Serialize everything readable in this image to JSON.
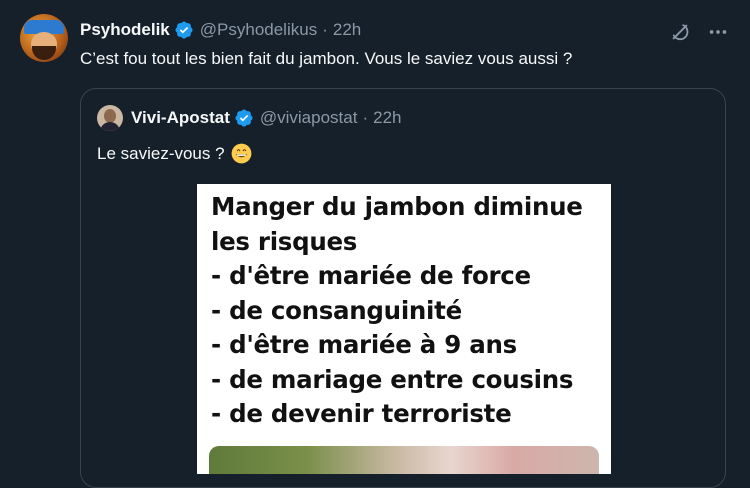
{
  "tweet": {
    "author_name": "Psyhodelik",
    "author_handle": "@Psyhodelikus",
    "separator": "·",
    "time": "22h",
    "text": "C’est fou tout les bien fait du jambon. Vous le saviez vous aussi ?"
  },
  "icons": {
    "verified": "verified-badge-icon",
    "grok": "grok-icon",
    "more": "more-options-icon",
    "emoji": "grinning-face-emoji"
  },
  "quoted_tweet": {
    "author_name": "Vivi-Apostat",
    "author_handle": "@viviapostat",
    "separator": "·",
    "time": "22h",
    "text": "Le saviez-vous ?",
    "media": {
      "lines": [
        "Manger du jambon diminue",
        "les risques",
        "-  d'être mariée de force",
        "-  de consanguinité",
        "-  d'être mariée à 9 ans",
        "-  de mariage entre cousins",
        "-  de devenir terroriste"
      ]
    }
  },
  "colors": {
    "background": "#15202b",
    "text_primary": "#f7f9f9",
    "text_secondary": "#8b98a5",
    "verified": "#1d9bf0",
    "border": "#38444d"
  }
}
